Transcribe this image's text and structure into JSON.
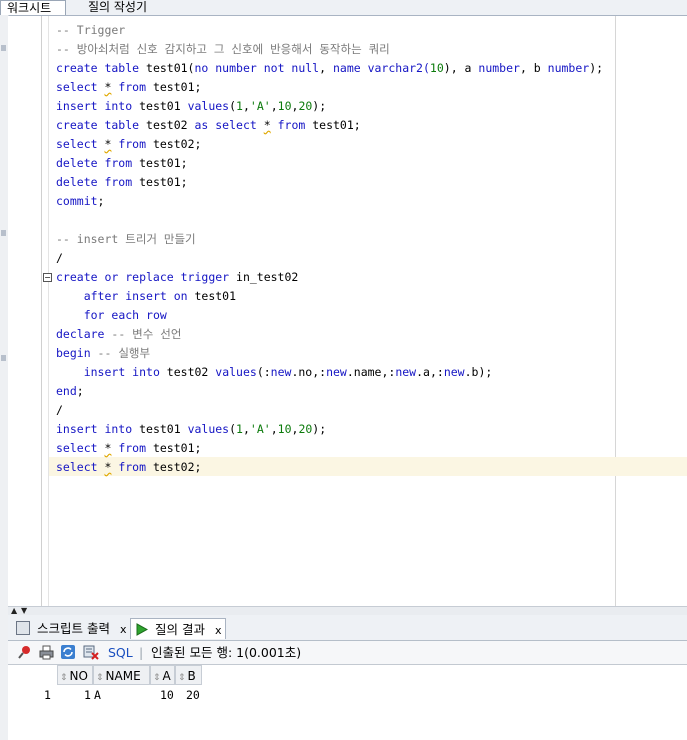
{
  "tabs": {
    "worksheet": "워크시트",
    "query_builder": "질의 작성기"
  },
  "editor": {
    "lines": [
      [
        {
          "t": "-- Trigger",
          "c": "cm"
        }
      ],
      [
        {
          "t": "-- 방아쇠처럼 신호 감지하고 그 신호에 반응해서 동작하는 쿼리",
          "c": "cm"
        }
      ],
      [
        {
          "t": "create table ",
          "c": "kw"
        },
        {
          "t": "test01("
        },
        {
          "t": "no number not null",
          "c": "kw"
        },
        {
          "t": ", "
        },
        {
          "t": "name varchar2(",
          "c": "kw"
        },
        {
          "t": "10",
          "c": "nm"
        },
        {
          "t": "), a "
        },
        {
          "t": "number",
          "c": "kw"
        },
        {
          "t": ", b "
        },
        {
          "t": "number",
          "c": "kw"
        },
        {
          "t": ");"
        }
      ],
      [
        {
          "t": "select ",
          "c": "kw"
        },
        {
          "t": "*",
          "c": "sq"
        },
        {
          "t": " from ",
          "c": "kw"
        },
        {
          "t": "test01;"
        }
      ],
      [
        {
          "t": "insert into ",
          "c": "kw"
        },
        {
          "t": "test01 "
        },
        {
          "t": "values",
          "c": "kw"
        },
        {
          "t": "("
        },
        {
          "t": "1",
          "c": "nm"
        },
        {
          "t": ","
        },
        {
          "t": "'A'",
          "c": "st"
        },
        {
          "t": ","
        },
        {
          "t": "10",
          "c": "nm"
        },
        {
          "t": ","
        },
        {
          "t": "20",
          "c": "nm"
        },
        {
          "t": ");"
        }
      ],
      [
        {
          "t": "create table ",
          "c": "kw"
        },
        {
          "t": "test02 "
        },
        {
          "t": "as select ",
          "c": "kw"
        },
        {
          "t": "*",
          "c": "sq"
        },
        {
          "t": " from ",
          "c": "kw"
        },
        {
          "t": "test01;"
        }
      ],
      [
        {
          "t": "select ",
          "c": "kw"
        },
        {
          "t": "*",
          "c": "sq"
        },
        {
          "t": " from ",
          "c": "kw"
        },
        {
          "t": "test02;"
        }
      ],
      [
        {
          "t": "delete from ",
          "c": "kw"
        },
        {
          "t": "test01;"
        }
      ],
      [
        {
          "t": "delete from ",
          "c": "kw"
        },
        {
          "t": "test01;"
        }
      ],
      [
        {
          "t": "commit",
          "c": "kw"
        },
        {
          "t": ";"
        }
      ],
      [
        {
          "t": ""
        }
      ],
      [
        {
          "t": "-- insert 트리거 만들기",
          "c": "cm"
        }
      ],
      [
        {
          "t": "/"
        }
      ],
      [
        {
          "t": "create or replace trigger ",
          "c": "kw"
        },
        {
          "t": "in_test02"
        }
      ],
      [
        {
          "t": "    "
        },
        {
          "t": "after insert on ",
          "c": "kw"
        },
        {
          "t": "test01"
        }
      ],
      [
        {
          "t": "    "
        },
        {
          "t": "for each row",
          "c": "kw"
        }
      ],
      [
        {
          "t": "declare ",
          "c": "kw"
        },
        {
          "t": "-- 변수 선언",
          "c": "cm"
        }
      ],
      [
        {
          "t": "begin ",
          "c": "kw"
        },
        {
          "t": "-- 실행부",
          "c": "cm"
        }
      ],
      [
        {
          "t": "    "
        },
        {
          "t": "insert into ",
          "c": "kw"
        },
        {
          "t": "test02 "
        },
        {
          "t": "values",
          "c": "kw"
        },
        {
          "t": "(:"
        },
        {
          "t": "new",
          "c": "kw"
        },
        {
          "t": ".no,:"
        },
        {
          "t": "new",
          "c": "kw"
        },
        {
          "t": ".name,:"
        },
        {
          "t": "new",
          "c": "kw"
        },
        {
          "t": ".a,:"
        },
        {
          "t": "new",
          "c": "kw"
        },
        {
          "t": ".b);"
        }
      ],
      [
        {
          "t": "end",
          "c": "kw"
        },
        {
          "t": ";"
        }
      ],
      [
        {
          "t": "/"
        }
      ],
      [
        {
          "t": "insert into ",
          "c": "kw"
        },
        {
          "t": "test01 "
        },
        {
          "t": "values",
          "c": "kw"
        },
        {
          "t": "("
        },
        {
          "t": "1",
          "c": "nm"
        },
        {
          "t": ","
        },
        {
          "t": "'A'",
          "c": "st"
        },
        {
          "t": ","
        },
        {
          "t": "10",
          "c": "nm"
        },
        {
          "t": ","
        },
        {
          "t": "20",
          "c": "nm"
        },
        {
          "t": ");"
        }
      ],
      [
        {
          "t": "select ",
          "c": "kw"
        },
        {
          "t": "*",
          "c": "sq"
        },
        {
          "t": " from ",
          "c": "kw"
        },
        {
          "t": "test01;"
        }
      ],
      [
        {
          "t": "select ",
          "c": "kw"
        },
        {
          "t": "*",
          "c": "sq"
        },
        {
          "t": " from ",
          "c": "kw"
        },
        {
          "t": "test02;"
        }
      ]
    ]
  },
  "output": {
    "tab_script": "스크립트 출력",
    "tab_query": "질의 결과",
    "close": "x",
    "sql_label": "SQL",
    "separator": "|",
    "status": "인출된 모든 행: 1(0.001초)",
    "columns": [
      "NO",
      "NAME",
      "A",
      "B"
    ],
    "rows": [
      {
        "rownum": "1",
        "cells": [
          "1",
          "A",
          "10",
          "20"
        ]
      }
    ]
  },
  "icons": {
    "pin": "pin-icon",
    "print": "print-icon",
    "refresh": "refresh-icon",
    "clear": "clear-icon",
    "run": "run-icon"
  },
  "colors": {
    "keyword": "#1515c4",
    "comment": "#7a7a7a",
    "literal": "#0b7a0b",
    "current_line": "#fbf6e3"
  }
}
